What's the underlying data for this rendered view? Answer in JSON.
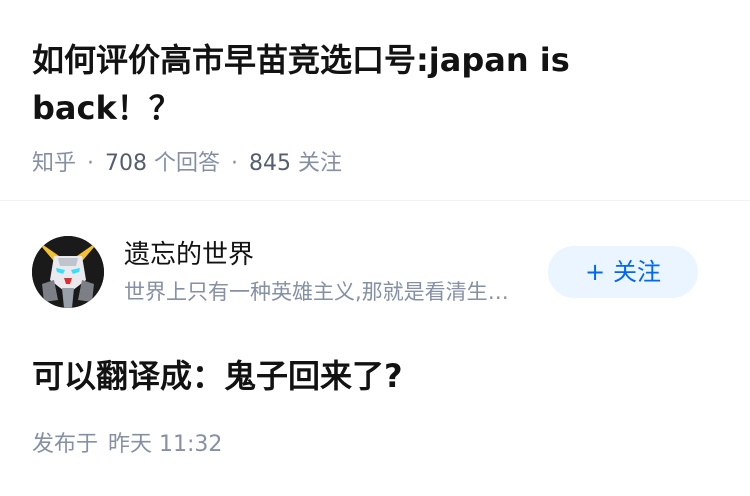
{
  "question": {
    "title": "如何评价高市早苗竞选口号:japan is back！？",
    "source": "知乎",
    "answers_count": "708",
    "answers_label": "个回答",
    "followers_count": "845",
    "followers_label": "关注"
  },
  "author": {
    "name": "遗忘的世界",
    "headline": "世界上只有一种英雄主义,那就是看清生活的真相之后依然热爱生活",
    "avatar_icon": "gundam-avatar-icon",
    "follow_label": "关注"
  },
  "answer": {
    "content": "可以翻译成：鬼子回来了?",
    "published_prefix": "发布于",
    "published_time": "昨天 11:32"
  },
  "colors": {
    "accent": "#0066ff",
    "accent_bg": "#ebf5ff",
    "meta_gray": "#8590a6"
  }
}
